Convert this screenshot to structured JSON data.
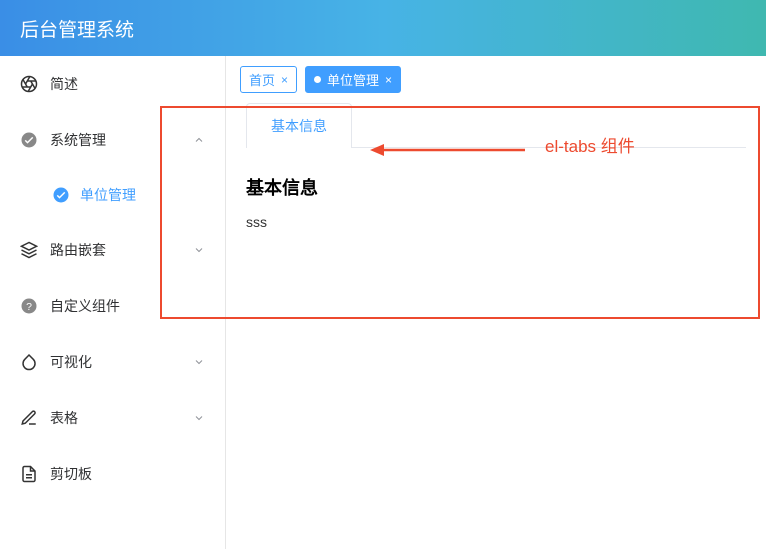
{
  "header": {
    "title": "后台管理系统"
  },
  "sidebar": {
    "items": [
      {
        "label": "简述",
        "icon": "aperture-icon",
        "expandable": false
      },
      {
        "label": "系统管理",
        "icon": "check-circle-icon",
        "expandable": true,
        "expanded": true,
        "children": [
          {
            "label": "单位管理",
            "icon": "check-circle-filled-icon",
            "active": true
          }
        ]
      },
      {
        "label": "路由嵌套",
        "icon": "layers-icon",
        "expandable": true
      },
      {
        "label": "自定义组件",
        "icon": "help-circle-icon",
        "expandable": false
      },
      {
        "label": "可视化",
        "icon": "drop-icon",
        "expandable": true
      },
      {
        "label": "表格",
        "icon": "edit-icon",
        "expandable": true
      },
      {
        "label": "剪切板",
        "icon": "document-icon",
        "expandable": false
      }
    ]
  },
  "tags": [
    {
      "label": "首页",
      "active": false,
      "closable": true
    },
    {
      "label": "单位管理",
      "active": true,
      "closable": true
    }
  ],
  "content": {
    "tabs": [
      {
        "label": "基本信息",
        "active": true
      }
    ],
    "panel": {
      "title": "基本信息",
      "body": "sss"
    }
  },
  "annotation": {
    "label": "el-tabs 组件"
  }
}
